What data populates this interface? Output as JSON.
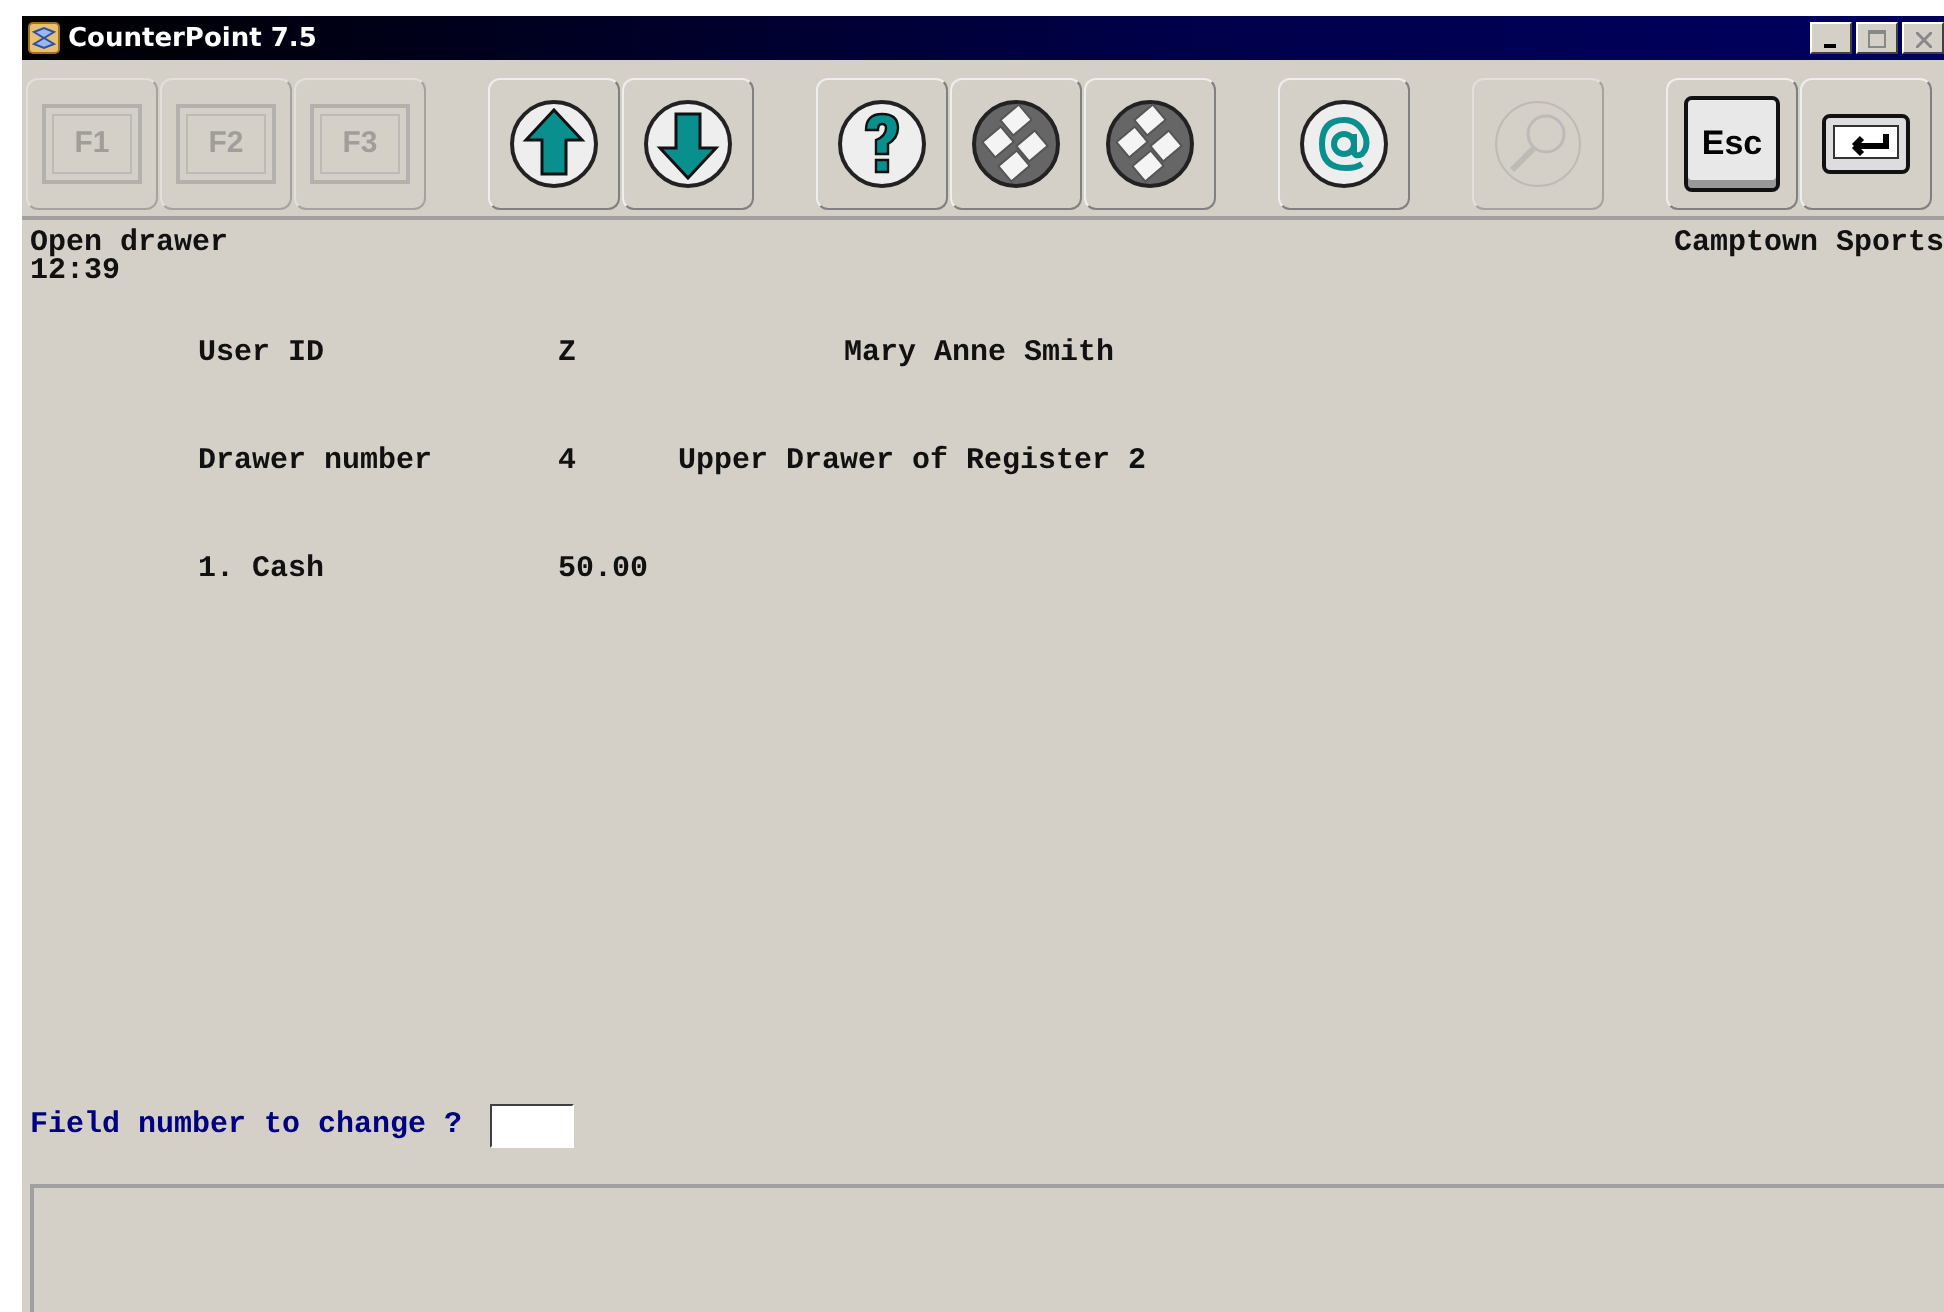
{
  "window": {
    "title": "CounterPoint 7.5"
  },
  "toolbar": [
    {
      "kind": "fkey",
      "label": "F1",
      "disabled": true
    },
    {
      "kind": "fkey",
      "label": "F2",
      "disabled": true
    },
    {
      "kind": "fkey",
      "label": "F3",
      "disabled": true
    },
    {
      "kind": "up",
      "disabled": false
    },
    {
      "kind": "down",
      "disabled": false
    },
    {
      "kind": "help",
      "disabled": false
    },
    {
      "kind": "keypad",
      "disabled": false
    },
    {
      "kind": "keypad",
      "disabled": false
    },
    {
      "kind": "at",
      "disabled": false
    },
    {
      "kind": "search",
      "disabled": true
    },
    {
      "kind": "esc",
      "label": "Esc",
      "disabled": false
    },
    {
      "kind": "enter",
      "disabled": false
    }
  ],
  "screen_title": "Open drawer",
  "time": "12:39",
  "company": "Camptown Sports",
  "fields": [
    {
      "kind": "user",
      "label": "User ID",
      "value": "Z",
      "description": "Mary Anne Smith"
    },
    {
      "kind": "drawer",
      "label": "Drawer number",
      "value": "4",
      "description": "Upper Drawer of Register 2"
    },
    {
      "kind": "amount",
      "label": "1. Cash",
      "value": "50.00"
    }
  ],
  "prompt": {
    "label": "Field number to change ?"
  }
}
